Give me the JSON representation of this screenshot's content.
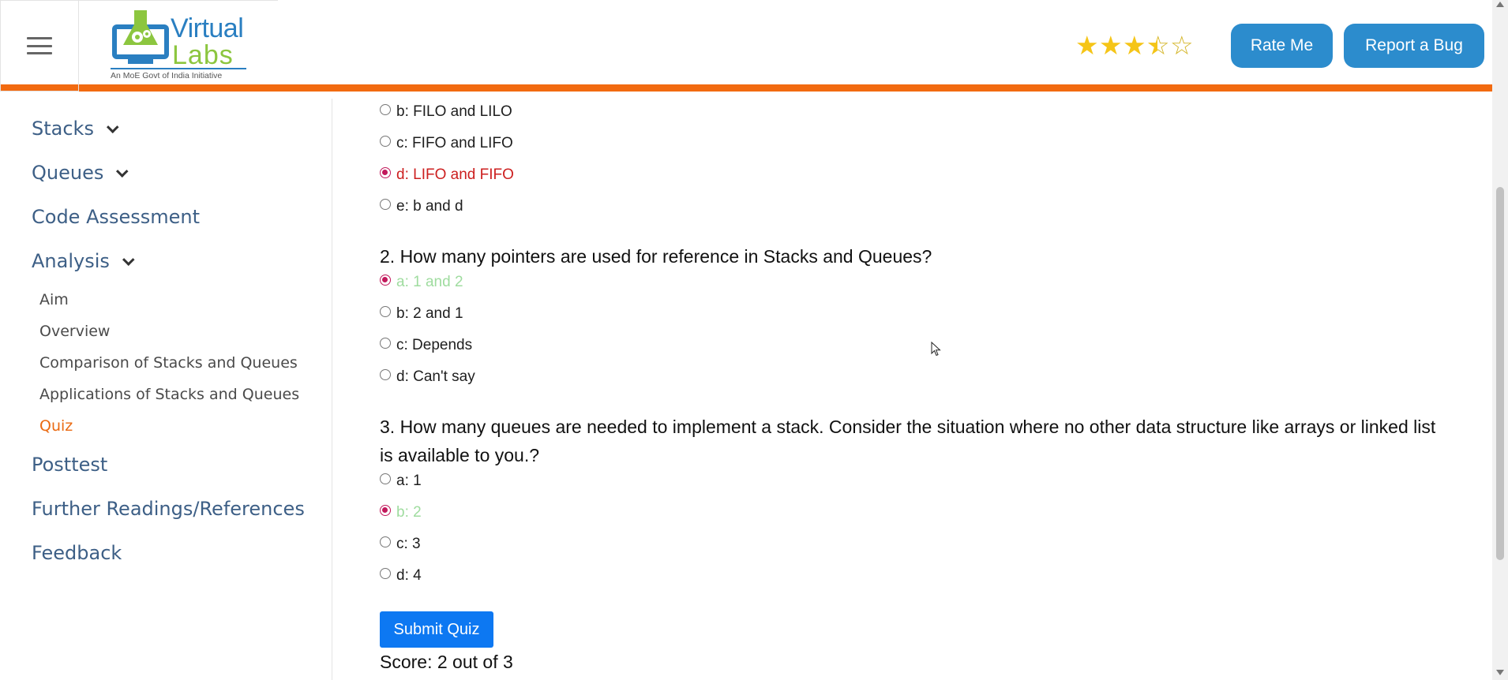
{
  "header": {
    "menu_icon": "hamburger-menu-icon",
    "logo": {
      "word1": "Virtual",
      "word2": "Labs",
      "tagline": "An MoE Govt of India Initiative",
      "icon": "flask-gear-icon"
    },
    "rating": {
      "value": 3.5,
      "max": 5,
      "icon": "star-icon"
    },
    "rate_button": "Rate Me",
    "bug_button": "Report a Bug",
    "accent_color": "#f26a10"
  },
  "sidebar": {
    "sections": [
      {
        "label": "Stacks",
        "expandable": true
      },
      {
        "label": "Queues",
        "expandable": true
      },
      {
        "label": "Code Assessment",
        "expandable": false
      },
      {
        "label": "Analysis",
        "expandable": true
      },
      {
        "label": "Posttest",
        "expandable": false
      },
      {
        "label": "Further Readings/References",
        "expandable": false
      },
      {
        "label": "Feedback",
        "expandable": false
      }
    ],
    "analysis_items": [
      {
        "label": "Aim"
      },
      {
        "label": "Overview"
      },
      {
        "label": "Comparison of Stacks and Queues"
      },
      {
        "label": "Applications of Stacks and Queues"
      },
      {
        "label": "Quiz",
        "active": true
      }
    ]
  },
  "quiz": {
    "q1_options": [
      {
        "label": "b: FILO and LILO",
        "checked": false,
        "state": "normal"
      },
      {
        "label": "c: FIFO and LIFO",
        "checked": false,
        "state": "normal"
      },
      {
        "label": "d: LIFO and FIFO",
        "checked": true,
        "state": "wrong"
      },
      {
        "label": "e: b and d",
        "checked": false,
        "state": "normal"
      }
    ],
    "q2": {
      "text": "2. How many pointers are used for reference in Stacks and Queues?",
      "options": [
        {
          "label": "a: 1 and 2",
          "checked": true,
          "state": "correct"
        },
        {
          "label": "b: 2 and 1",
          "checked": false,
          "state": "normal"
        },
        {
          "label": "c: Depends",
          "checked": false,
          "state": "normal"
        },
        {
          "label": "d: Can't say",
          "checked": false,
          "state": "normal"
        }
      ]
    },
    "q3": {
      "text": "3. How many queues are needed to implement a stack. Consider the situation where no other data structure like arrays or linked list is available to you.?",
      "options": [
        {
          "label": "a: 1",
          "checked": false,
          "state": "normal"
        },
        {
          "label": "b: 2",
          "checked": true,
          "state": "correct"
        },
        {
          "label": "c: 3",
          "checked": false,
          "state": "normal"
        },
        {
          "label": "d: 4",
          "checked": false,
          "state": "normal"
        }
      ]
    },
    "submit_label": "Submit Quiz",
    "score_text": "Score: 2 out of 3",
    "colors": {
      "wrong": "#cc1f1f",
      "correct": "#9fdc9f",
      "radio_checked": "#c2185b",
      "submit": "#0d78f2"
    }
  }
}
